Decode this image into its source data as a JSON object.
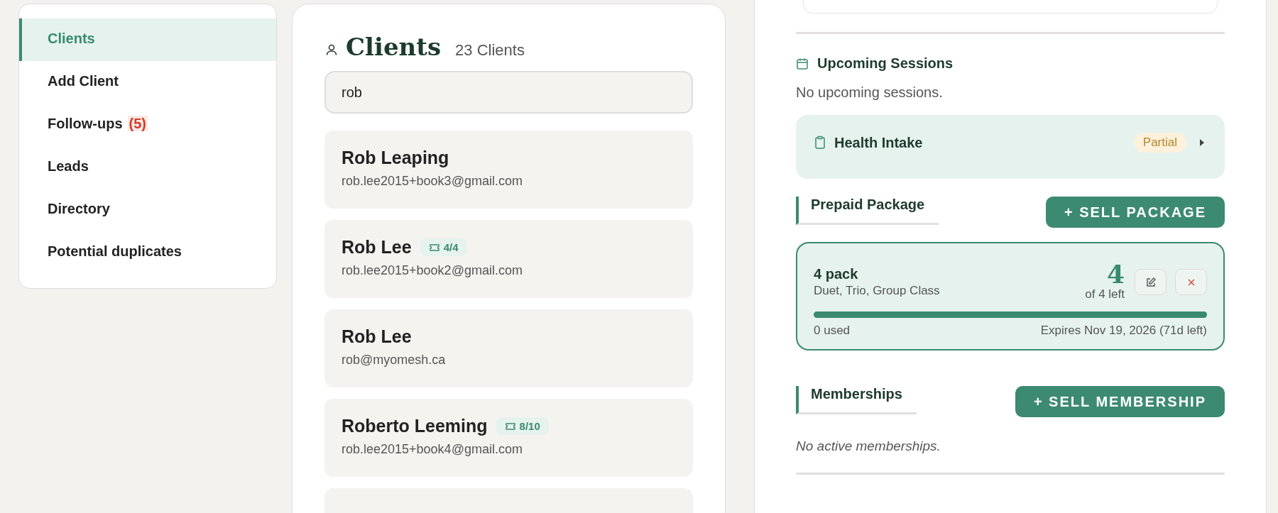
{
  "sidebar": {
    "items": [
      {
        "label": "Clients",
        "selected": true
      },
      {
        "label": "Add Client",
        "selected": false
      },
      {
        "label": "Follow-ups",
        "count": "(5)",
        "selected": false
      },
      {
        "label": "Leads",
        "selected": false
      },
      {
        "label": "Directory",
        "selected": false
      },
      {
        "label": "Potential duplicates",
        "selected": false
      }
    ]
  },
  "clients_panel": {
    "title": "Clients",
    "count": "23 Clients",
    "search": {
      "value": "rob"
    },
    "clients": [
      {
        "name": "Rob Leaping",
        "email": "rob.lee2015+book3@gmail.com"
      },
      {
        "name": "Rob Lee",
        "badge": "4/4",
        "email": "rob.lee2015+book2@gmail.com"
      },
      {
        "name": "Rob Lee",
        "email": "rob@myomesh.ca"
      },
      {
        "name": "Roberto Leeming",
        "badge": "8/10",
        "email": "rob.lee2015+book4@gmail.com"
      }
    ]
  },
  "detail": {
    "upcoming": {
      "title": "Upcoming Sessions",
      "empty_text": "No upcoming sessions."
    },
    "intake": {
      "title": "Health Intake",
      "status": "Partial"
    },
    "package_section": {
      "title": "Prepaid Package",
      "button": "+ SELL PACKAGE",
      "package": {
        "name": "4 pack",
        "services": "Duet, Trio, Group Class",
        "remaining": "4",
        "remaining_label": "of 4 left",
        "level": 1,
        "used": "0 used",
        "expires": "Expires Nov 19, 2026 (71d left)"
      }
    },
    "memberships": {
      "title": "Memberships",
      "button": "+ SELL MEMBERSHIP",
      "empty_text": "No active memberships."
    }
  }
}
